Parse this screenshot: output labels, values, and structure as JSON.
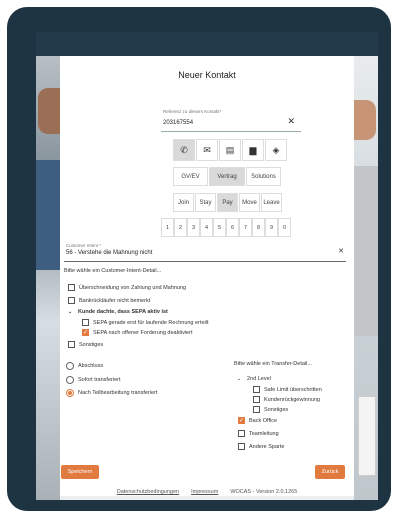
{
  "dialog": {
    "title": "Neuer Kontakt",
    "reference": {
      "label": "Referenz zu diesem Kontakt*",
      "value": "203167554"
    },
    "channels": [
      {
        "name": "phone-icon",
        "glyph": "✆",
        "selected": true
      },
      {
        "name": "email-icon",
        "glyph": "✉",
        "selected": false
      },
      {
        "name": "document-icon",
        "glyph": "▤",
        "selected": false
      },
      {
        "name": "chat-icon",
        "glyph": "▆",
        "selected": false
      },
      {
        "name": "diamond-icon",
        "glyph": "◈",
        "selected": false
      }
    ],
    "categories": [
      {
        "label": "GV/EV",
        "selected": false
      },
      {
        "label": "Vertrag",
        "selected": true
      },
      {
        "label": "Solutions",
        "selected": false
      }
    ],
    "phases": [
      {
        "label": "Join",
        "selected": false
      },
      {
        "label": "Stay",
        "selected": false
      },
      {
        "label": "Pay",
        "selected": true
      },
      {
        "label": "Move",
        "selected": false
      },
      {
        "label": "Leave",
        "selected": false
      }
    ],
    "numbers": [
      "1",
      "2",
      "3",
      "4",
      "5",
      "6",
      "7",
      "8",
      "9",
      "0"
    ],
    "intent": {
      "label": "Customer Intent *",
      "value": "56 - Verstehe die Mahnung nicht"
    },
    "intent_detail_prompt": "Bitte wähle ein Customer-Intent-Detail...",
    "intent_details": {
      "overlap": "Überschneidung von Zahlung und Mahnung",
      "bank": "Bankrückläufer nicht bemerkt",
      "sepa_group": "Kunde dachte, dass SEPA aktiv ist",
      "sepa_1": "SEPA gerade erst für laufende Rechnung erteilt",
      "sepa_2": "SEPA nach offener Forderung deaktiviert",
      "other": "Sonstiges"
    },
    "resolution": {
      "abschluss": "Abschluss",
      "sofort": "Sofort transferiert",
      "nach": "Nach Teilbearbeitung transferiert"
    },
    "transfer_prompt": "Bitte wähle ein Transfer-Detail...",
    "transfer": {
      "level2": "2nd Level",
      "safe_limit": "Safe Limit überschritten",
      "kundenrueck": "Kundenrückgewinnung",
      "sonstiges": "Sonstiges",
      "back_office": "Back Office",
      "teamleitung": "Teamleitung",
      "andere": "Andere Sparte"
    },
    "save_label": "Speichern",
    "back_label": "Zurück"
  },
  "footer": {
    "privacy": "Datenschutzbedingungen",
    "imprint": "Impressum",
    "version": "WOCAS - Version 2.0.1265"
  },
  "colors": {
    "accent": "#e07a3e",
    "frame": "#1f3442",
    "topbar": "#233a4a"
  }
}
